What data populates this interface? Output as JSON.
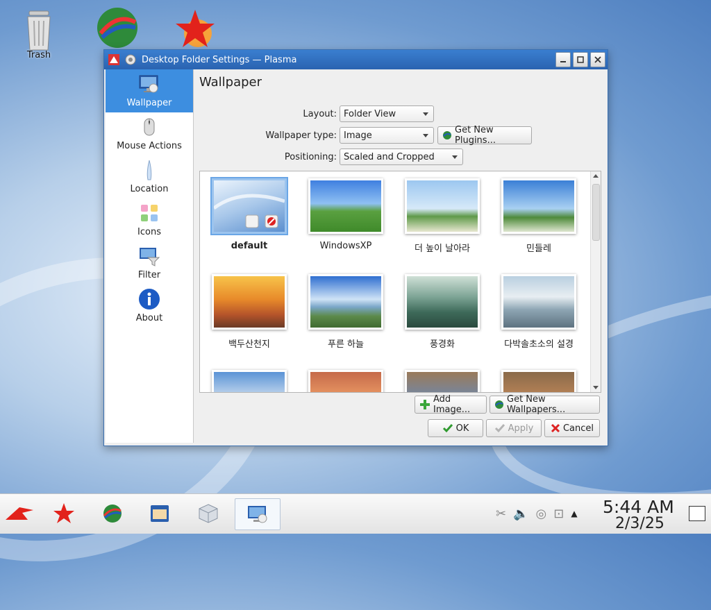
{
  "desktop": {
    "icons": [
      {
        "label": "Trash"
      },
      {
        "label": ""
      },
      {
        "label": ""
      }
    ]
  },
  "window": {
    "title": "Desktop Folder Settings — Plasma",
    "sidebar": {
      "items": [
        {
          "label": "Wallpaper",
          "icon": "monitor-icon",
          "active": true
        },
        {
          "label": "Mouse Actions",
          "icon": "mouse-icon"
        },
        {
          "label": "Location",
          "icon": "location-icon"
        },
        {
          "label": "Icons",
          "icon": "icons-grid-icon"
        },
        {
          "label": "Filter",
          "icon": "filter-icon"
        },
        {
          "label": "About",
          "icon": "info-icon"
        }
      ]
    },
    "page_title": "Wallpaper",
    "form": {
      "layout_label": "Layout:",
      "layout_value": "Folder View",
      "type_label": "Wallpaper type:",
      "type_value": "Image",
      "get_plugins": "Get New Plugins...",
      "positioning_label": "Positioning:",
      "positioning_value": "Scaled and Cropped"
    },
    "wallpapers": [
      {
        "name": "default",
        "selected": true
      },
      {
        "name": "WindowsXP"
      },
      {
        "name": "더 높이 날아라"
      },
      {
        "name": "민들레"
      },
      {
        "name": "백두산천지"
      },
      {
        "name": "푸른 하늘"
      },
      {
        "name": "풍경화"
      },
      {
        "name": "다박솔초소의 설경"
      },
      {
        "name": ""
      },
      {
        "name": ""
      },
      {
        "name": ""
      },
      {
        "name": ""
      }
    ],
    "buttons": {
      "add_image": "Add Image...",
      "get_wallpapers": "Get New Wallpapers...",
      "ok": "OK",
      "apply": "Apply",
      "cancel": "Cancel"
    }
  },
  "taskbar": {
    "clock_time": "5:44 AM",
    "clock_date": "2/3/25"
  },
  "colors": {
    "accent": "#3d8ee0",
    "titlebar": "#2a63b0"
  }
}
